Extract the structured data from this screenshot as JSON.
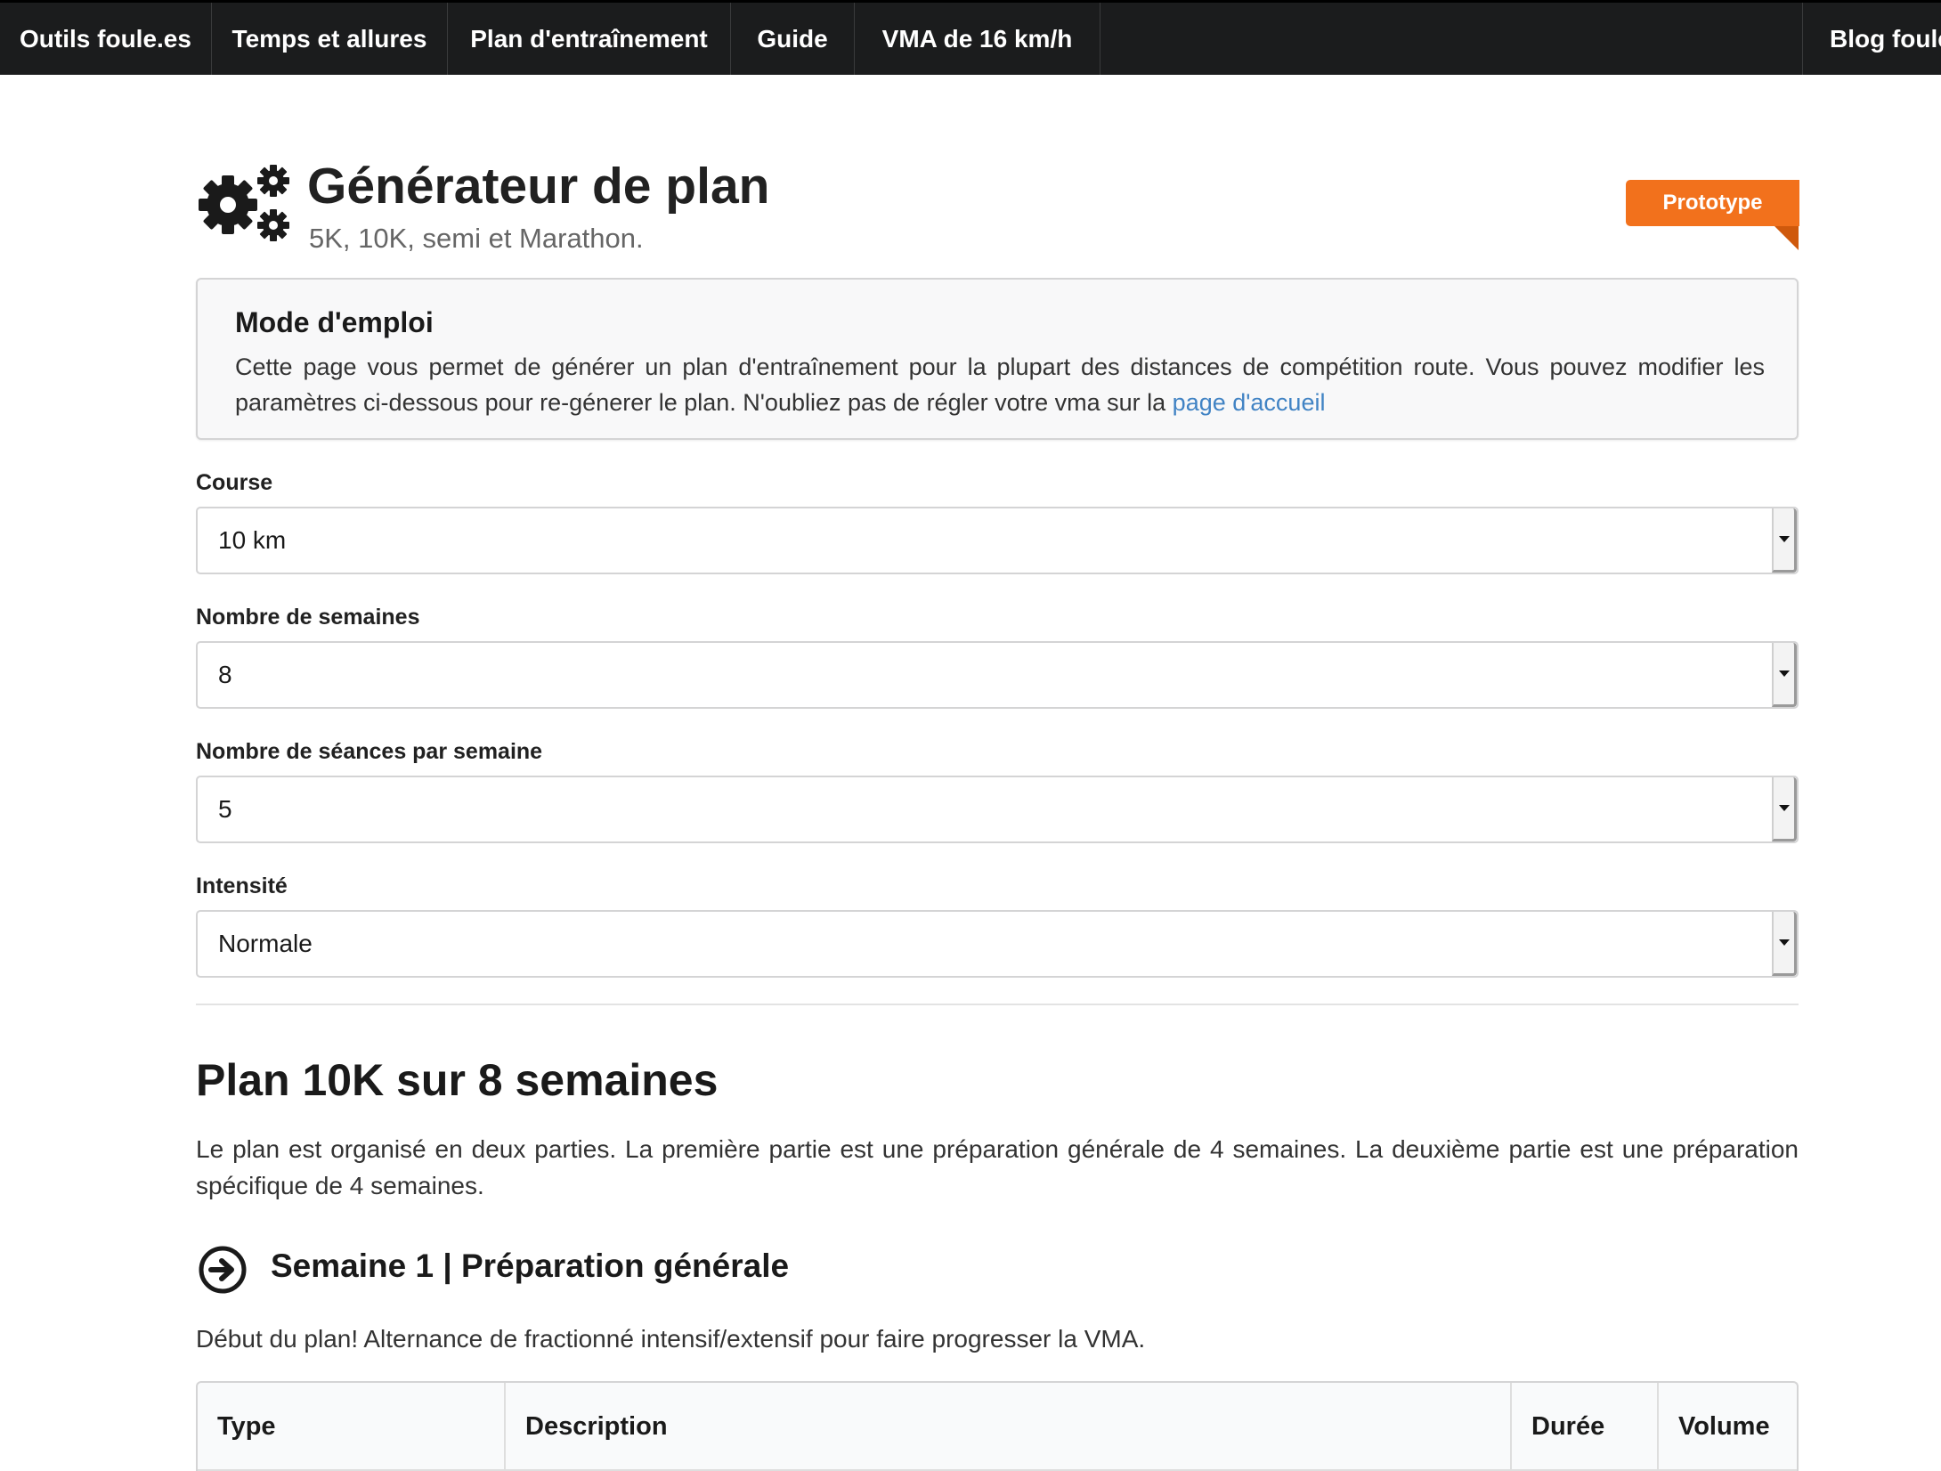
{
  "nav": {
    "items": [
      {
        "label": "Outils foule.es"
      },
      {
        "label": "Temps et allures"
      },
      {
        "label": "Plan d'entraînement"
      },
      {
        "label": "Guide"
      },
      {
        "label": "VMA de 16 km/h"
      }
    ],
    "right_item": {
      "label": "Blog foule"
    }
  },
  "header": {
    "title": "Générateur de plan",
    "subtitle": "5K, 10K, semi et Marathon.",
    "ribbon": "Prototype",
    "icon": "gears-icon"
  },
  "info": {
    "title": "Mode d'emploi",
    "text": "Cette page vous permet de générer un plan d'entraînement pour la plupart des distances de compétition route. Vous pouvez modifier les paramètres ci-dessous pour re-génerer le plan. N'oubliez pas de régler votre vma sur la ",
    "link": "page d'accueil"
  },
  "form": {
    "course": {
      "label": "Course",
      "value": "10 km"
    },
    "weeks": {
      "label": "Nombre de semaines",
      "value": "8"
    },
    "sessions": {
      "label": "Nombre de séances par semaine",
      "value": "5"
    },
    "intensity": {
      "label": "Intensité",
      "value": "Normale"
    }
  },
  "plan": {
    "title": "Plan 10K sur 8 semaines",
    "description": "Le plan est organisé en deux parties. La première partie est une préparation générale de 4 semaines. La deuxième partie est une préparation spécifique de 4 semaines.",
    "week1": {
      "title": "Semaine 1 | Préparation générale",
      "icon": "arrow-circle-right-icon",
      "description": "Début du plan! Alternance de fractionné intensif/extensif pour faire progresser la VMA."
    },
    "table": {
      "headers": [
        "Type",
        "Description",
        "Durée",
        "Volume"
      ]
    }
  },
  "colors": {
    "nav_bg": "#1b1c1d",
    "ribbon": "#f2711c",
    "link": "#4183c4"
  }
}
